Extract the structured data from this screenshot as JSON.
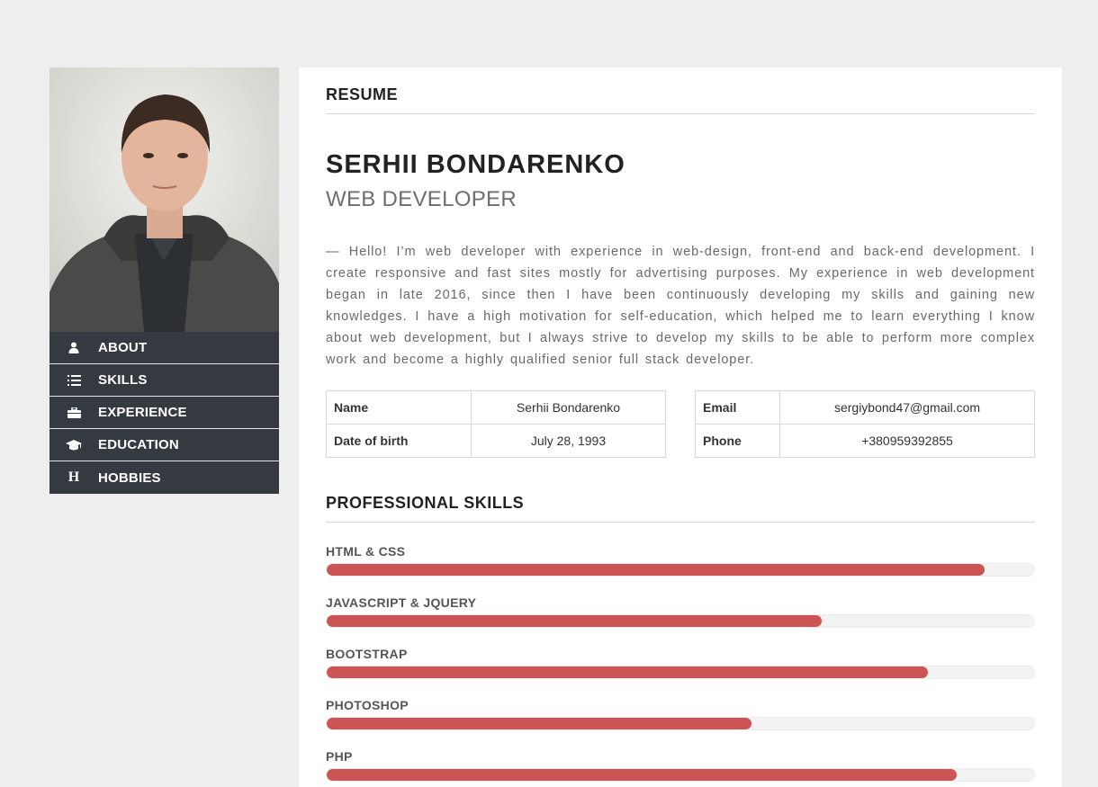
{
  "sidebar": {
    "photo_alt": "Serhii Bondarenko",
    "items": [
      {
        "label": "ABOUT",
        "icon": "user-icon"
      },
      {
        "label": "SKILLS",
        "icon": "list-icon"
      },
      {
        "label": "EXPERIENCE",
        "icon": "briefcase-icon"
      },
      {
        "label": "EDUCATION",
        "icon": "graduation-cap-icon"
      },
      {
        "label": "HOBBIES",
        "icon": "h-icon"
      }
    ]
  },
  "resume": {
    "section_title": "RESUME",
    "name": "SERHII BONDARENKO",
    "role": "WEB DEVELOPER",
    "about": "— Hello! I’m web developer with experience in web-design, front-end and back-end development. I create responsive and fast sites mostly for advertising purposes. My experience in web development began in late 2016, since then I have been continuously developing my skills and gaining new knowledges. I have a high motivation for self-education, which helped me to learn everything I know about web development, but I always strive to develop my skills to be able to perform more complex work and become a highly qualified senior full stack developer.",
    "info_left": [
      {
        "key": "Name",
        "value": "Serhii Bondarenko"
      },
      {
        "key": "Date of birth",
        "value": "July 28, 1993"
      }
    ],
    "info_right": [
      {
        "key": "Email",
        "value": "sergiybond47@gmail.com"
      },
      {
        "key": "Phone",
        "value": "+380959392855"
      }
    ]
  },
  "skills": {
    "title": "PROFESSIONAL SKILLS",
    "bar_color": "#cc5454",
    "items": [
      {
        "label": "HTML & CSS",
        "percent": 93
      },
      {
        "label": "JAVASCRIPT & JQUERY",
        "percent": 70
      },
      {
        "label": "BOOTSTRAP",
        "percent": 85
      },
      {
        "label": "PHOTOSHOP",
        "percent": 60
      },
      {
        "label": "PHP",
        "percent": 89
      }
    ]
  }
}
